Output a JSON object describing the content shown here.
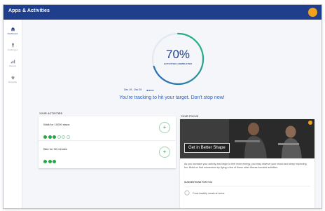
{
  "app": {
    "title": "Apps & Activities",
    "avatar_initial": ""
  },
  "sidebar": {
    "items": [
      {
        "label": "Dashboard",
        "icon": "home-icon",
        "active": true
      },
      {
        "label": "Challenges",
        "icon": "trophy-icon",
        "active": false
      },
      {
        "label": "Metrics",
        "icon": "bar-chart-icon",
        "active": false
      },
      {
        "label": "Rewards",
        "icon": "star-icon",
        "active": false
      }
    ]
  },
  "progress": {
    "value_text": "70%",
    "fraction": 0.7,
    "label": "ACTIVITIES COMPLETED",
    "period": "Dec 19 - Dec 25",
    "dots": "●●●●",
    "message": "You're tracking to hit your target. Don't stop now!",
    "ring_start_color": "#2c62c0",
    "ring_end_color": "#27c07a"
  },
  "activities": {
    "heading": "YOUR ACTIVITIES",
    "items": [
      {
        "name": "Walk for 10000 steps",
        "done": 3,
        "total": 6
      },
      {
        "name": "Bike for 30 minutes",
        "done": 3,
        "total": 3
      }
    ],
    "done_color": "#27a844"
  },
  "focus": {
    "heading": "YOUR FOCUS",
    "chip_label": "Get in Better Shape",
    "body": "As you increase your activity and begin to feel more energy, you may observe your mood and sleep improving, too. Build on that momentum by trying a few of these other fitness-focused activities.",
    "suggestions_heading": "SUGGESTIONS FOR YOU",
    "suggestion": "Cook healthy meals at home"
  }
}
